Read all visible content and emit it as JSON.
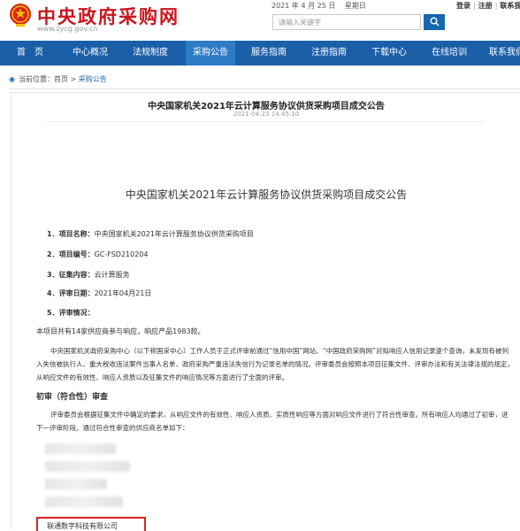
{
  "header": {
    "site_name": "中央政府采购网",
    "site_domain": "www.zycg.gov.cn",
    "date": "2021 年 4 月 25 日",
    "weekday": "星期日",
    "links": [
      "登录",
      "注册",
      "联系我们"
    ],
    "search_placeholder": "请输入关键字"
  },
  "nav": {
    "items": [
      "首　页",
      "中心概况",
      "法规制度",
      "采购公告",
      "服务指南",
      "注册指南",
      "下载中心",
      "在线培训",
      "联系我们"
    ],
    "active_index": 3
  },
  "breadcrumb": {
    "label": "当前位置：",
    "home": "首页",
    "sep": " > ",
    "current": "采购公告"
  },
  "article": {
    "title": "中央国家机关2021年云计算服务协议供货采购项目成交公告",
    "time": "2021-04-23 14:45:10",
    "heading": "中央国家机关2021年云计算服务协议供货采购项目成交公告",
    "items": [
      {
        "label": "1．项目名称：",
        "value": "中央国家机关2021年云计算服务协议供货采购项目"
      },
      {
        "label": "2．项目编号：",
        "value": "GC-FSD210204"
      },
      {
        "label": "3．征集内容：",
        "value": "云计算服务"
      },
      {
        "label": "4．评审日期：",
        "value": "2021年04月21日"
      },
      {
        "label": "5．评审情况：",
        "value": ""
      }
    ],
    "summary": "本项目共有14家供应商参与响应，响应产品1983款。",
    "para1": "中央国家机关政府采购中心（以下称国采中心）工作人员于正式评审前通过“信用中国”网站、“中国政府采购网”对拟响应人信用记录逐个查询，未发现有被列入失信被执行人、重大税收违法案件当事人名单、政府采购严重违法失信行为记录名单的情况。评审委员会按照本项目征集文件、评审办法和有关法律法规的规定，从响应文件的有效性、响应人资质以及征集文件的响应情况等方面进行了全面的评审。",
    "section_title": "初审（符合性）审查",
    "para2": "评审委员会根据征集文件中确定的要求，从响应文件的有效性、响应人资质、实质性响应等方面对响应文件进行了符合性审查。所有响应人均通过了初审，进下一评审阶段。通过符合性审查的供应商名单如下：",
    "highlighted_supplier": "联通数字科技有限公司"
  },
  "colors": {
    "brand_red": "#c8161d",
    "nav_blue": "#1a5fa8",
    "nav_active": "#2e7bc6",
    "highlight_border": "#d9261c"
  }
}
